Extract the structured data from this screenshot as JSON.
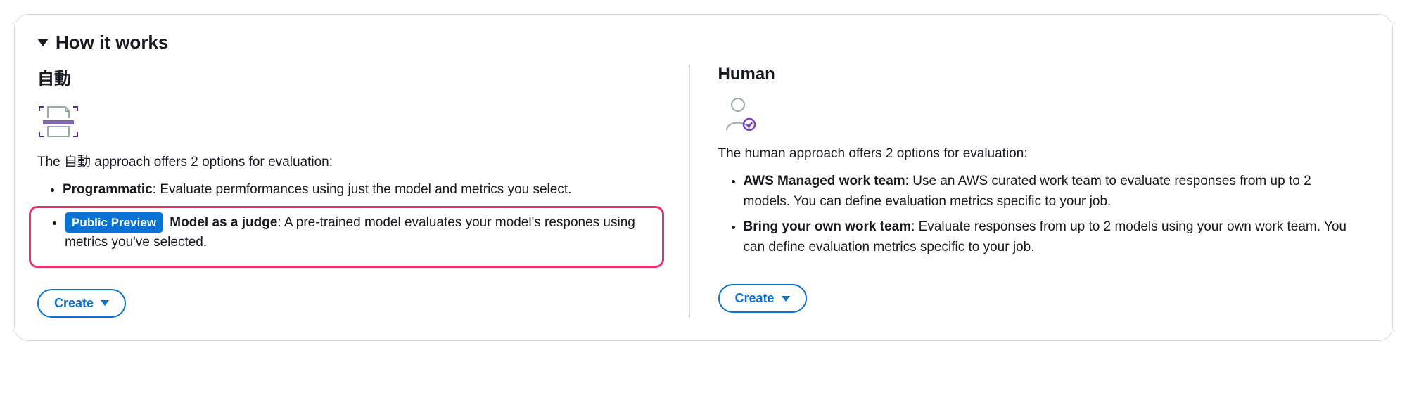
{
  "section_title": "How it works",
  "auto": {
    "title": "自動",
    "intro": "The 自動 approach offers 2 options for evaluation:",
    "options": [
      {
        "label": "Programmatic",
        "desc": ": Evaluate permformances using just the model and metrics you select.",
        "badge": null
      },
      {
        "label": "Model as a judge",
        "desc": ": A pre-trained model evaluates your model's respones using metrics you've selected.",
        "badge": "Public Preview"
      }
    ],
    "create_label": "Create"
  },
  "human": {
    "title": "Human",
    "intro": "The human approach offers 2 options for evaluation:",
    "options": [
      {
        "label": "AWS Managed work team",
        "desc": ": Use an AWS curated work team to evaluate responses from up to 2 models. You can define evaluation metrics specific to your job.",
        "badge": null
      },
      {
        "label": "Bring your own work team",
        "desc": ": Evaluate responses from up to 2 models using your own work team. You can define evaluation metrics specific to your job.",
        "badge": null
      }
    ],
    "create_label": "Create"
  }
}
